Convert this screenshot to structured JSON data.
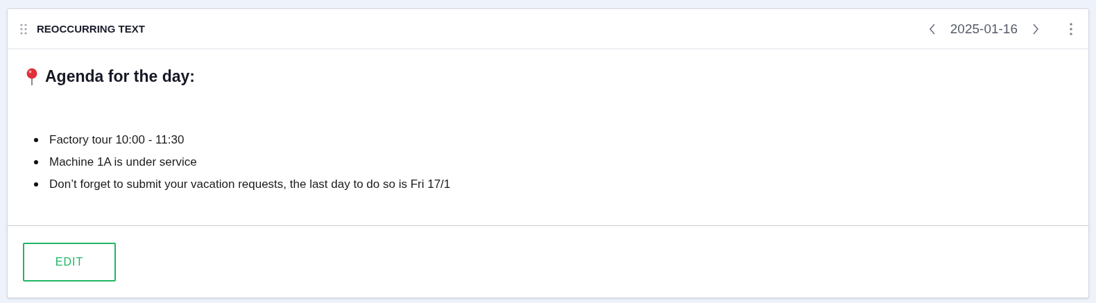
{
  "widget": {
    "title": "REOCCURRING TEXT",
    "date": "2025-01-16"
  },
  "content": {
    "heading": "Agenda for the day:",
    "items": [
      "Factory tour 10:00 - 11:30",
      "Machine 1A is under service",
      "Don’t forget to submit your vacation requests, the last day to do so is Fri 17/1"
    ]
  },
  "footer": {
    "buttons": [
      "EDIT"
    ]
  }
}
